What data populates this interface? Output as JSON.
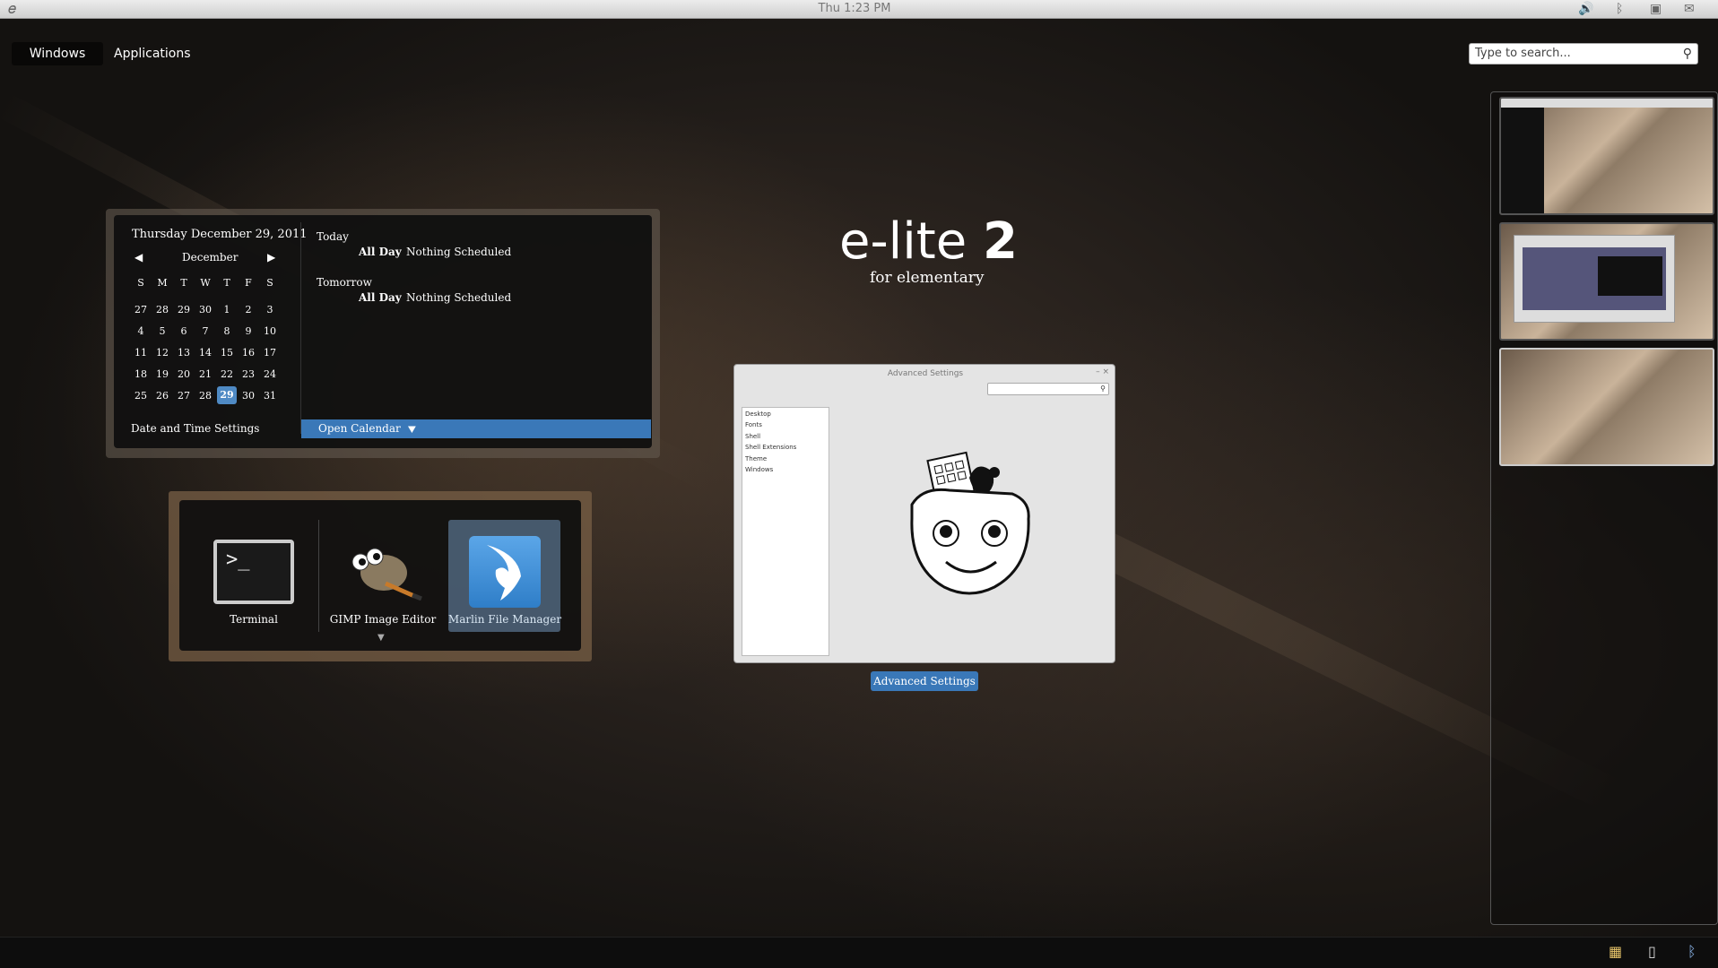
{
  "top_panel": {
    "clock": "Thu  1:23 PM",
    "icons": [
      "elementary-logo-icon",
      "volume-icon",
      "bluetooth-icon",
      "network-icon",
      "messages-icon"
    ]
  },
  "tabs": {
    "windows": "Windows",
    "applications": "Applications"
  },
  "search": {
    "placeholder": "Type to search..."
  },
  "branding": {
    "title": "e-lite",
    "version": "2",
    "subtitle": "for elementary"
  },
  "calendar": {
    "date_heading": "Thursday December 29, 2011",
    "month": "December",
    "weekdays": [
      "S",
      "M",
      "T",
      "W",
      "T",
      "F",
      "S"
    ],
    "weeks": [
      [
        "27",
        "28",
        "29",
        "30",
        "1",
        "2",
        "3"
      ],
      [
        "4",
        "5",
        "6",
        "7",
        "8",
        "9",
        "10"
      ],
      [
        "11",
        "12",
        "13",
        "14",
        "15",
        "16",
        "17"
      ],
      [
        "18",
        "19",
        "20",
        "21",
        "22",
        "23",
        "24"
      ],
      [
        "25",
        "26",
        "27",
        "28",
        "29",
        "30",
        "31"
      ]
    ],
    "selected_day": "29",
    "events": [
      {
        "day": "Today",
        "time": "All Day",
        "text": "Nothing Scheduled"
      },
      {
        "day": "Tomorrow",
        "time": "All Day",
        "text": "Nothing Scheduled"
      }
    ],
    "settings_link": "Date and Time Settings",
    "open_button": "Open Calendar"
  },
  "switcher": {
    "apps": [
      {
        "label": "Terminal",
        "icon": "terminal-icon"
      },
      {
        "label": "GIMP Image Editor",
        "icon": "gimp-icon"
      },
      {
        "label": "Marlin File Manager",
        "icon": "marlin-icon"
      }
    ],
    "selected": "Marlin File Manager"
  },
  "window": {
    "title": "Advanced Settings",
    "sidebar": [
      "Desktop",
      "Fonts",
      "Shell",
      "Shell Extensions",
      "Theme",
      "Windows"
    ],
    "caption": "Advanced Settings"
  },
  "bottom_panel": {
    "icons": [
      "workspace-icon",
      "device-icon",
      "bluetooth-icon"
    ]
  }
}
